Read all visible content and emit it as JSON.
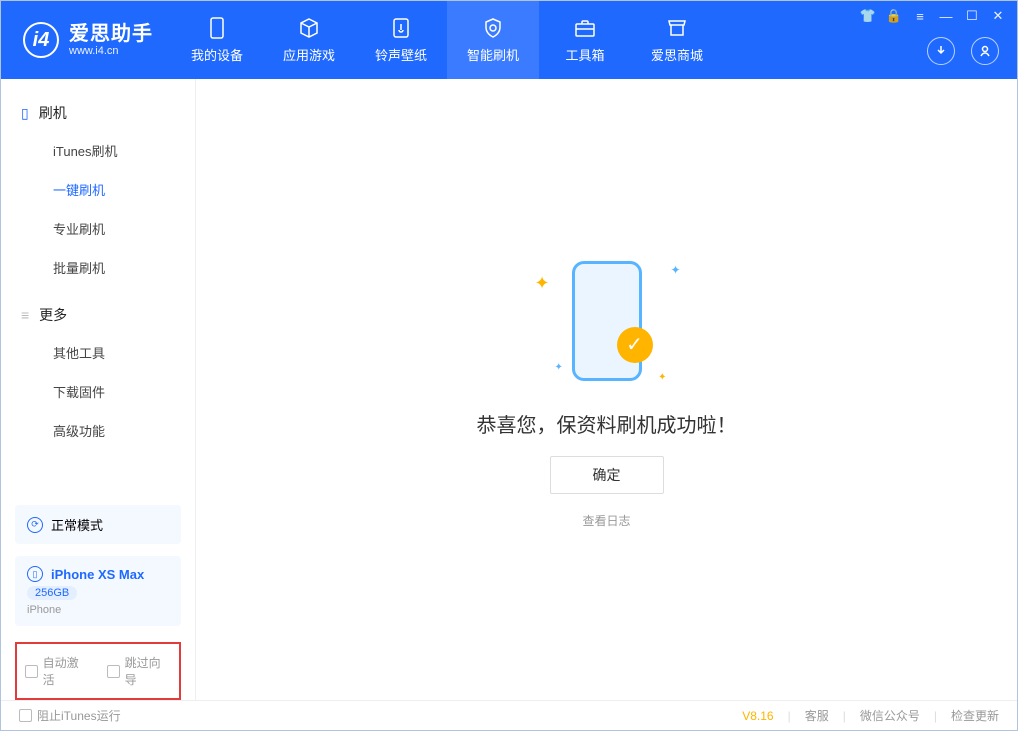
{
  "header": {
    "logo_title": "爱思助手",
    "logo_sub": "www.i4.cn",
    "nav": [
      "我的设备",
      "应用游戏",
      "铃声壁纸",
      "智能刷机",
      "工具箱",
      "爱思商城"
    ]
  },
  "sidebar": {
    "group1": "刷机",
    "items1": [
      "iTunes刷机",
      "一键刷机",
      "专业刷机",
      "批量刷机"
    ],
    "group2": "更多",
    "items2": [
      "其他工具",
      "下载固件",
      "高级功能"
    ]
  },
  "mode": {
    "label": "正常模式"
  },
  "device": {
    "name": "iPhone XS Max",
    "storage": "256GB",
    "type": "iPhone"
  },
  "opts": {
    "auto_activate": "自动激活",
    "skip_guide": "跳过向导"
  },
  "main": {
    "success": "恭喜您，保资料刷机成功啦！",
    "ok": "确定",
    "view_log": "查看日志"
  },
  "footer": {
    "block_itunes": "阻止iTunes运行",
    "version": "V8.16",
    "support": "客服",
    "wechat": "微信公众号",
    "check_update": "检查更新"
  }
}
